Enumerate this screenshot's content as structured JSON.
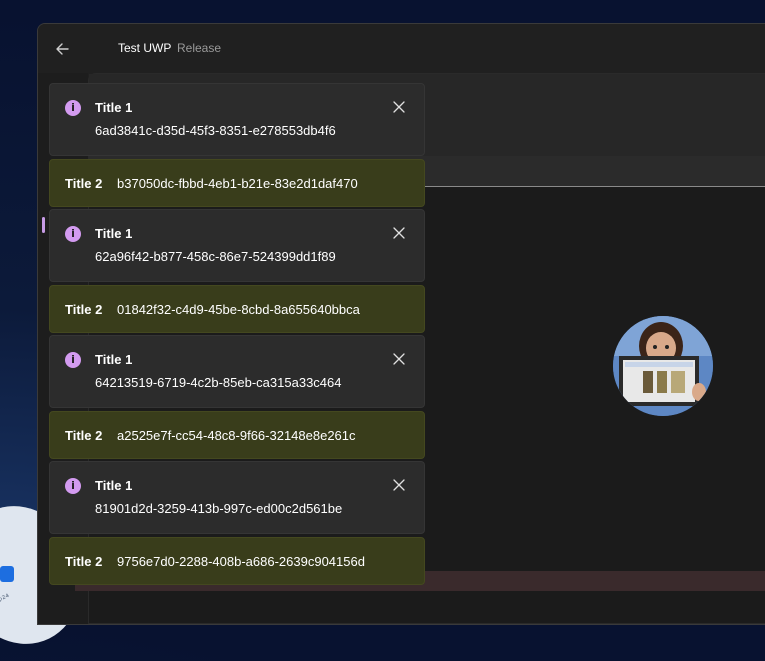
{
  "app": {
    "title": "Test UWP",
    "subtitle": "Release"
  },
  "notifications": [
    {
      "type": "info",
      "title": "Title 1",
      "message": "6ad3841c-d35d-45f3-8351-e278553db4f6"
    },
    {
      "type": "warning",
      "title": "Title 2",
      "message": "b37050dc-fbbd-4eb1-b21e-83e2d1daf470"
    },
    {
      "type": "info",
      "title": "Title 1",
      "message": "62a96f42-b877-458c-86e7-524399dd1f89"
    },
    {
      "type": "warning",
      "title": "Title 2",
      "message": "01842f32-c4d9-45be-8cbd-8a655640bbca"
    },
    {
      "type": "info",
      "title": "Title 1",
      "message": "64213519-6719-4c2b-85eb-ca315a33c464"
    },
    {
      "type": "warning",
      "title": "Title 2",
      "message": "a2525e7f-cc54-48c8-9f66-32148e8e261c"
    },
    {
      "type": "info",
      "title": "Title 1",
      "message": "81901d2d-3259-413b-997c-ed00c2d561be"
    },
    {
      "type": "warning",
      "title": "Title 2",
      "message": "9756e7d0-2288-408b-a686-2639c904156d"
    }
  ],
  "icons": {
    "back": "back-arrow-icon",
    "info": "info-icon",
    "close": "close-icon"
  },
  "colors": {
    "info_icon": "#d39bf0",
    "warning_background": "#393d1b",
    "info_background": "#2c2c2c",
    "nav_accent": "#c79be6"
  }
}
